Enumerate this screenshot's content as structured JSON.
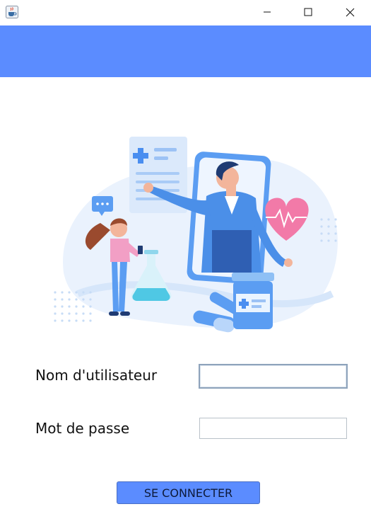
{
  "window": {
    "app_icon": "java-cup-icon",
    "controls": [
      "minimize-icon",
      "maximize-icon",
      "close-icon"
    ]
  },
  "colors": {
    "header": "#5b8cff",
    "button": "#5b8cff",
    "illustration_accent": "#4a8ef0",
    "heart": "#f27aa8"
  },
  "form": {
    "username_label": "Nom d'utilisateur",
    "username_value": "",
    "password_label": "Mot de passe",
    "password_value": "",
    "submit_label": "SE CONNECTER"
  }
}
